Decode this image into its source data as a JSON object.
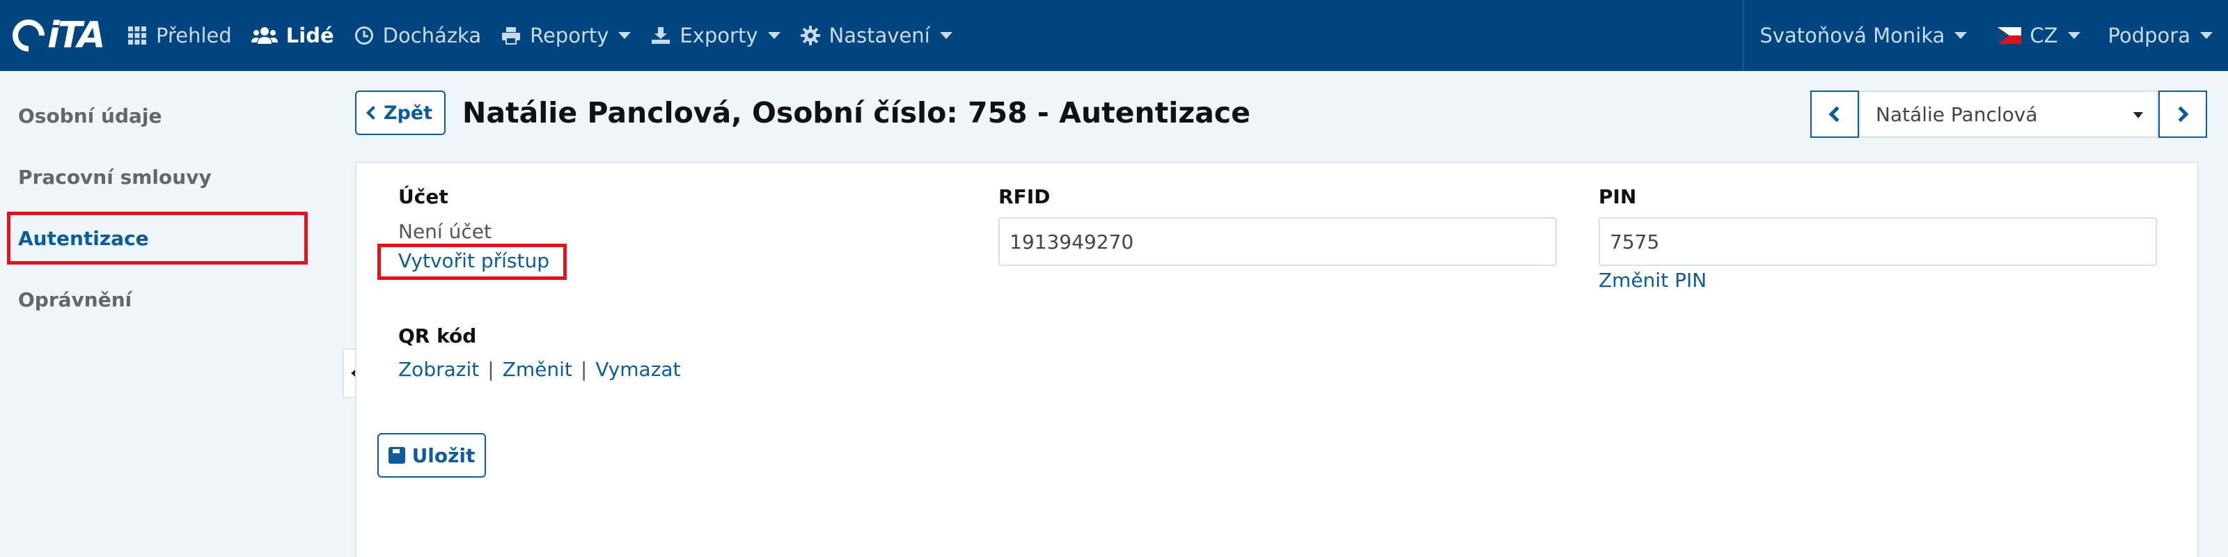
{
  "brand": {
    "logo_text": "iTA",
    "accent": "#00457f",
    "highlight": "#e0141e"
  },
  "nav": {
    "items": [
      {
        "label": "Přehled",
        "icon": "grid-icon"
      },
      {
        "label": "Lidé",
        "icon": "users-icon",
        "active": true
      },
      {
        "label": "Docházka",
        "icon": "clock-icon"
      },
      {
        "label": "Reporty",
        "icon": "print-icon"
      },
      {
        "label": "Exporty",
        "icon": "export-icon"
      },
      {
        "label": "Nastavení",
        "icon": "gear-icon"
      }
    ],
    "user": "Svatoňová Monika",
    "language": "CZ",
    "support": "Podpora"
  },
  "sidebar": {
    "items": [
      {
        "label": "Osobní údaje"
      },
      {
        "label": "Pracovní smlouvy"
      },
      {
        "label": "Autentizace",
        "active": true
      },
      {
        "label": "Oprávnění"
      }
    ]
  },
  "header": {
    "back_label": "Zpět",
    "title": "Natálie Panclová, Osobní číslo: 758 - Autentizace",
    "selected_person": "Natálie Panclová"
  },
  "form": {
    "account": {
      "label": "Účet",
      "status": "Není účet",
      "create_link": "Vytvořit přístup"
    },
    "rfid": {
      "label": "RFID",
      "value": "1913949270"
    },
    "pin": {
      "label": "PIN",
      "value": "7575",
      "change_link": "Změnit PIN"
    },
    "qr": {
      "label": "QR kód",
      "show": "Zobrazit",
      "change": "Změnit",
      "delete": "Vymazat",
      "separator": "|"
    },
    "save_label": "Uložit"
  }
}
